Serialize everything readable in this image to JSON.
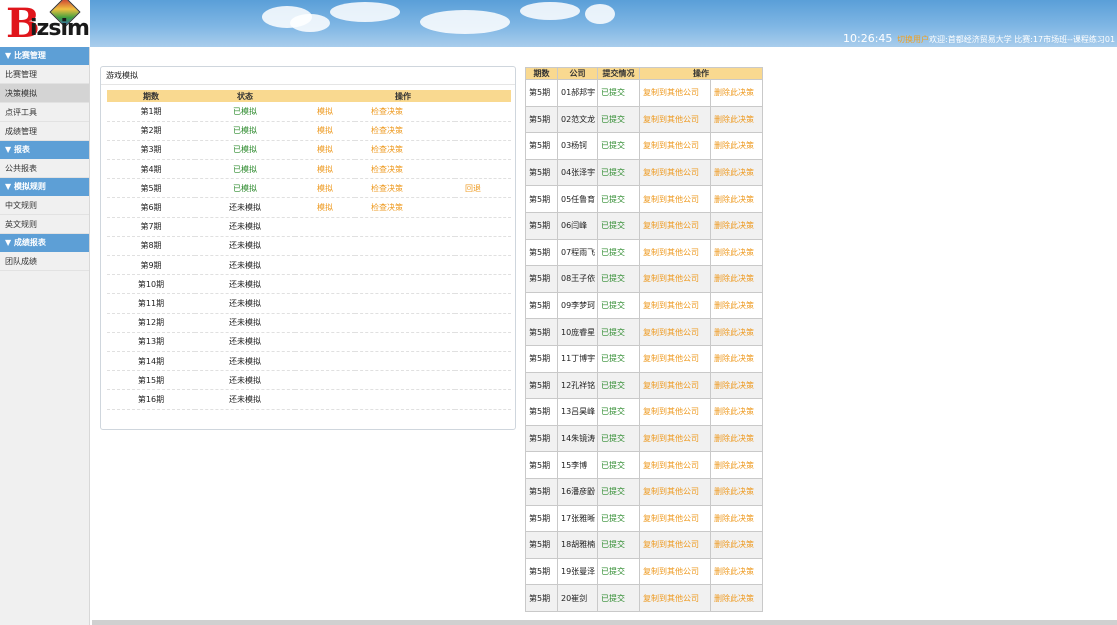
{
  "header": {
    "logo_b": "B",
    "logo_rest": "izsim",
    "time": "10:26:45",
    "switch_user": "切换用户",
    "welcome": "欢迎:首都经济贸易大学 比赛:17市场班--课程练习01"
  },
  "sidebar": {
    "sections": [
      {
        "title": "▼ 比赛管理",
        "items": [
          {
            "label": "比赛管理",
            "active": false
          },
          {
            "label": "决策模拟",
            "active": true
          },
          {
            "label": "点评工具",
            "active": false
          },
          {
            "label": "成绩管理",
            "active": false
          }
        ]
      },
      {
        "title": "▼ 报表",
        "items": [
          {
            "label": "公共报表",
            "active": false
          }
        ]
      },
      {
        "title": "▼ 模拟规则",
        "items": [
          {
            "label": "中文规则",
            "active": false
          },
          {
            "label": "英文规则",
            "active": false
          }
        ]
      },
      {
        "title": "▼ 成绩报表",
        "items": [
          {
            "label": "团队成绩",
            "active": false
          }
        ]
      }
    ]
  },
  "game_panel": {
    "title": "游戏模拟",
    "headers": {
      "period": "期数",
      "status": "状态",
      "operation": "操作"
    },
    "rows": [
      {
        "period": "第1期",
        "status": "已模拟",
        "simulated": true,
        "sim": "模拟",
        "check": "检查决策",
        "back": ""
      },
      {
        "period": "第2期",
        "status": "已模拟",
        "simulated": true,
        "sim": "模拟",
        "check": "检查决策",
        "back": ""
      },
      {
        "period": "第3期",
        "status": "已模拟",
        "simulated": true,
        "sim": "模拟",
        "check": "检查决策",
        "back": ""
      },
      {
        "period": "第4期",
        "status": "已模拟",
        "simulated": true,
        "sim": "模拟",
        "check": "检查决策",
        "back": ""
      },
      {
        "period": "第5期",
        "status": "已模拟",
        "simulated": true,
        "sim": "模拟",
        "check": "检查决策",
        "back": "回退"
      },
      {
        "period": "第6期",
        "status": "还未模拟",
        "simulated": false,
        "sim": "模拟",
        "check": "检查决策",
        "back": ""
      },
      {
        "period": "第7期",
        "status": "还未模拟",
        "simulated": false,
        "sim": "",
        "check": "",
        "back": ""
      },
      {
        "period": "第8期",
        "status": "还未模拟",
        "simulated": false,
        "sim": "",
        "check": "",
        "back": ""
      },
      {
        "period": "第9期",
        "status": "还未模拟",
        "simulated": false,
        "sim": "",
        "check": "",
        "back": ""
      },
      {
        "period": "第10期",
        "status": "还未模拟",
        "simulated": false,
        "sim": "",
        "check": "",
        "back": ""
      },
      {
        "period": "第11期",
        "status": "还未模拟",
        "simulated": false,
        "sim": "",
        "check": "",
        "back": ""
      },
      {
        "period": "第12期",
        "status": "还未模拟",
        "simulated": false,
        "sim": "",
        "check": "",
        "back": ""
      },
      {
        "period": "第13期",
        "status": "还未模拟",
        "simulated": false,
        "sim": "",
        "check": "",
        "back": ""
      },
      {
        "period": "第14期",
        "status": "还未模拟",
        "simulated": false,
        "sim": "",
        "check": "",
        "back": ""
      },
      {
        "period": "第15期",
        "status": "还未模拟",
        "simulated": false,
        "sim": "",
        "check": "",
        "back": ""
      },
      {
        "period": "第16期",
        "status": "还未模拟",
        "simulated": false,
        "sim": "",
        "check": "",
        "back": ""
      }
    ]
  },
  "submission_table": {
    "headers": {
      "period": "期数",
      "company": "公司",
      "submit": "提交情况",
      "operation": "操作"
    },
    "copy_label": "复制到其他公司",
    "delete_label": "删除此决策",
    "rows": [
      {
        "period": "第5期",
        "company": "01郝邦宇",
        "submit": "已提交"
      },
      {
        "period": "第5期",
        "company": "02范文龙",
        "submit": "已提交"
      },
      {
        "period": "第5期",
        "company": "03杨钶",
        "submit": "已提交"
      },
      {
        "period": "第5期",
        "company": "04张泽宇",
        "submit": "已提交"
      },
      {
        "period": "第5期",
        "company": "05任鲁育",
        "submit": "已提交"
      },
      {
        "period": "第5期",
        "company": "06闫峰",
        "submit": "已提交"
      },
      {
        "period": "第5期",
        "company": "07程雨飞",
        "submit": "已提交"
      },
      {
        "period": "第5期",
        "company": "08王子依",
        "submit": "已提交"
      },
      {
        "period": "第5期",
        "company": "09李梦珂",
        "submit": "已提交"
      },
      {
        "period": "第5期",
        "company": "10庞睿星",
        "submit": "已提交"
      },
      {
        "period": "第5期",
        "company": "11丁博宇",
        "submit": "已提交"
      },
      {
        "period": "第5期",
        "company": "12孔祥铭",
        "submit": "已提交"
      },
      {
        "period": "第5期",
        "company": "13吕昊峰",
        "submit": "已提交"
      },
      {
        "period": "第5期",
        "company": "14朱镜涛",
        "submit": "已提交"
      },
      {
        "period": "第5期",
        "company": "15李博",
        "submit": "已提交"
      },
      {
        "period": "第5期",
        "company": "16潘彦鼢",
        "submit": "已提交"
      },
      {
        "period": "第5期",
        "company": "17张雅晰",
        "submit": "已提交"
      },
      {
        "period": "第5期",
        "company": "18胡雅楠",
        "submit": "已提交"
      },
      {
        "period": "第5期",
        "company": "19张曼泽",
        "submit": "已提交"
      },
      {
        "period": "第5期",
        "company": "20崔剑",
        "submit": "已提交"
      }
    ]
  },
  "colors": {
    "header_blue": "#5a9fd8",
    "sidebar_head": "#5d9fd6",
    "table_head": "#f9d990",
    "status_green": "#2e8b2e",
    "link_orange": "#ee9a20"
  }
}
